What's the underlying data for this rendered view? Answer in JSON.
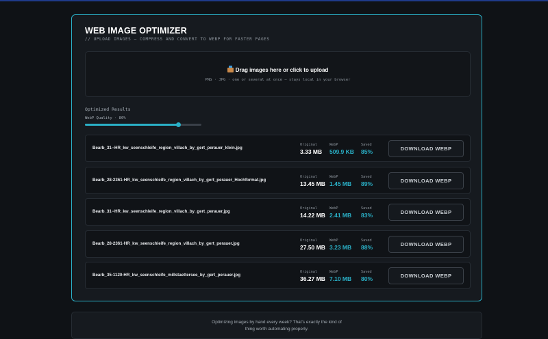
{
  "header": {
    "title": "WEB IMAGE OPTIMIZER",
    "subtitle": "// UPLOAD IMAGES — COMPRESS AND CONVERT TO WEBP FOR FASTER PAGES"
  },
  "dropzone": {
    "main_text": "Drag images here or click to upload",
    "sub_text": "PNG · JPG · one or several at once — stays local in your browser",
    "icon": "package-icon"
  },
  "results": {
    "label": "Optimized Results",
    "quality_label": "WebP Quality · 80%",
    "quality_value": 0.8,
    "stat_labels": {
      "original": "Original",
      "webp": "WebP",
      "saved": "Saved"
    },
    "download_label": "DOWNLOAD WEBP",
    "files": [
      {
        "name": "Bearb_31--HR_kw_seenschleife_region_villach_by_gert_perauer_klein.jpg",
        "original": "3.33 MB",
        "webp": "509.9 KB",
        "saved": "85%"
      },
      {
        "name": "Bearb_28-2361-HR_kw_seenschleife_region_villach_by_gert_perauer_Hochformat.jpg",
        "original": "13.45 MB",
        "webp": "1.45 MB",
        "saved": "89%"
      },
      {
        "name": "Bearb_31--HR_kw_seenschleife_region_villach_by_gert_perauer.jpg",
        "original": "14.22 MB",
        "webp": "2.41 MB",
        "saved": "83%"
      },
      {
        "name": "Bearb_28-2361-HR_kw_seenschleife_region_villach_by_gert_perauer.jpg",
        "original": "27.50 MB",
        "webp": "3.23 MB",
        "saved": "88%"
      },
      {
        "name": "Bearb_35-1120-HR_kw_seenschleife_millstaettersee_by_gert_perauer.jpg",
        "original": "36.27 MB",
        "webp": "7.10 MB",
        "saved": "80%"
      }
    ]
  },
  "footer": {
    "line1": "Optimizing images by hand every week? That's exactly the kind of",
    "line2": "thing worth automating properly."
  },
  "colors": {
    "accent": "#2ab0c7",
    "background": "#0f1216",
    "panel": "#161a1f"
  }
}
